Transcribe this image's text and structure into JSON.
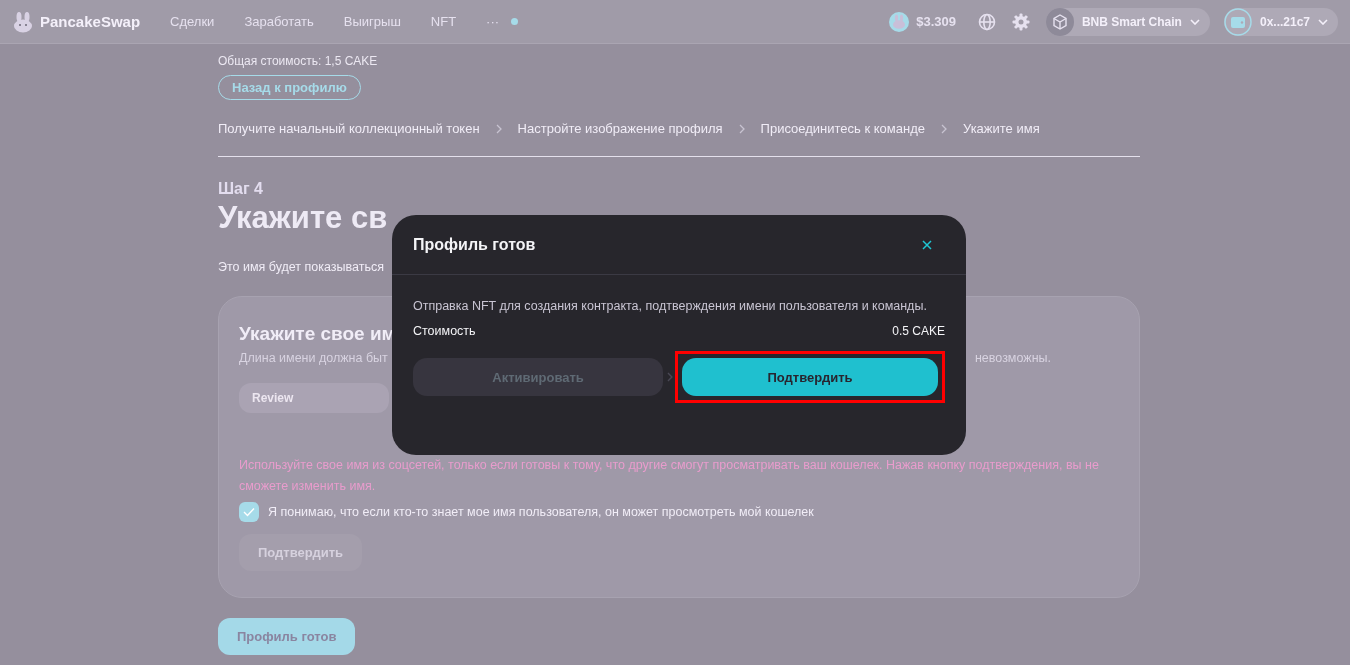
{
  "nav": {
    "logo": "PancakeSwap",
    "links": [
      "Сделки",
      "Заработать",
      "Выигрыш",
      "NFT"
    ],
    "more": "···",
    "notification": true,
    "price": "$3.309",
    "network": "BNB Smart Chain",
    "wallet": "0x...21c7"
  },
  "page": {
    "total_cost": "Общая стоимость: 1,5 CAKE",
    "back_button": "Назад к профилю",
    "steps": [
      "Получите начальный коллекционный токен",
      "Настройте изображение профиля",
      "Присоединитесь к команде",
      "Укажите имя"
    ],
    "step_label": "Шаг 4",
    "heading": "Укажите св",
    "intro": "Это имя будет показываться",
    "card": {
      "title": "Укажите свое им",
      "description_start": "Длина имени должна быт",
      "description_end": "невозможны.",
      "input": {
        "placeholder": "Review"
      },
      "warning": "Используйте свое имя из соцсетей, только если готовы к тому, что другие смогут просматривать ваш кошелек. Нажав кнопку подтверждения, вы не сможете изменить имя.",
      "checkbox": {
        "label": "Я понимаю, что если кто-то знает мое имя пользователя, он может просмотреть мой кошелек",
        "checked": true
      },
      "confirm_button": {
        "label": "Подтвердить",
        "disabled": true
      }
    },
    "footer_button": {
      "label": "Профиль готов",
      "disabled": true
    }
  },
  "modal": {
    "title": "Профиль готов",
    "text": "Отправка NFT для создания контракта, подтверждения имени пользователя и команды.",
    "cost_label": "Стоимость",
    "cost_value": "0.5 CAKE",
    "buttons": [
      {
        "label": "Активировать",
        "disabled": true,
        "highlighted": false
      },
      {
        "label": "Подтвердить",
        "disabled": false,
        "highlighted": true
      }
    ]
  }
}
